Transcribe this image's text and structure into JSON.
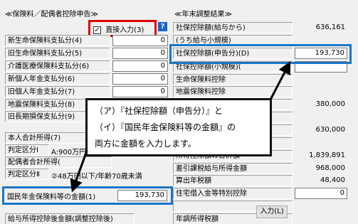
{
  "left": {
    "section_title": "≪保険料／配偶者控除申告≫",
    "direct_input_label": "直接入力(3)",
    "direct_input_checked": "✓",
    "rows": [
      {
        "label": "新生命保険料支払分(4)",
        "value": "0"
      },
      {
        "label": "旧生命保険料支払分(5)",
        "value": "0"
      },
      {
        "label": "介護医療保険料支払分(6)",
        "value": "0"
      },
      {
        "label": "新個人年金支払分(6)",
        "value": "0"
      },
      {
        "label": "旧個人年金支払分(7)",
        "value": "0"
      },
      {
        "label": "地震保険料支払分(8)",
        "value": "0"
      },
      {
        "label": "旧長期損保支払分(9)",
        "value": "0"
      }
    ],
    "honnin_label": "本人合計所得(7)",
    "hantei1_label": "判定区分Ⅰ",
    "hantei1_value": "A:900万円",
    "haigusha_label": "配偶者合計所得(",
    "hantei2_label": "判定区分Ⅱ",
    "hantei2_value": "②48万円以下/年齢70歳未満",
    "kokumin_label": "国民年金保険料等の金額(1)",
    "kokumin_value": "193,730",
    "bottom_label": "給与所得控除後金額(調整控除後)"
  },
  "right": {
    "section_title": "≪年末調整結果≫",
    "rows": [
      {
        "label": "社保控除額(給与から)",
        "value": "636,161"
      },
      {
        "label": "(うち給与小規模)",
        "value": ""
      },
      {
        "label": "社保控除額(申告分)(D)",
        "value": "193,730"
      },
      {
        "label": "社保控除額(小規模)(",
        "value": ""
      },
      {
        "label": "生命保険料控除",
        "value": ""
      },
      {
        "label": "地震保険料控除",
        "value": ""
      },
      {
        "label": "",
        "value": "380,000"
      },
      {
        "label": "",
        "value": ""
      },
      {
        "label": "",
        "value": "630,000"
      },
      {
        "label": "",
        "value": ""
      },
      {
        "label": "所得控除額の合計額",
        "value": "1,839,891"
      },
      {
        "label": "差引課税給与所得金額",
        "value": "968,000"
      },
      {
        "label": "算出年税額",
        "value": "48,400"
      },
      {
        "label": "住宅借入金等特別控除",
        "value": "0"
      },
      {
        "label": "",
        "value": ""
      },
      {
        "label": "年調所得税額",
        "value": ""
      }
    ],
    "input_button_label": "入力(L)"
  },
  "callout": {
    "line1": "（ア）『社保控除額（申告分）』と",
    "line2": "（イ）『国民年金保険料等の金額』の",
    "line3": "両方に金額を入力します。"
  },
  "colors": {
    "highlight": "#1a76c8",
    "red": "#e00000",
    "help": "#1c64c8"
  }
}
